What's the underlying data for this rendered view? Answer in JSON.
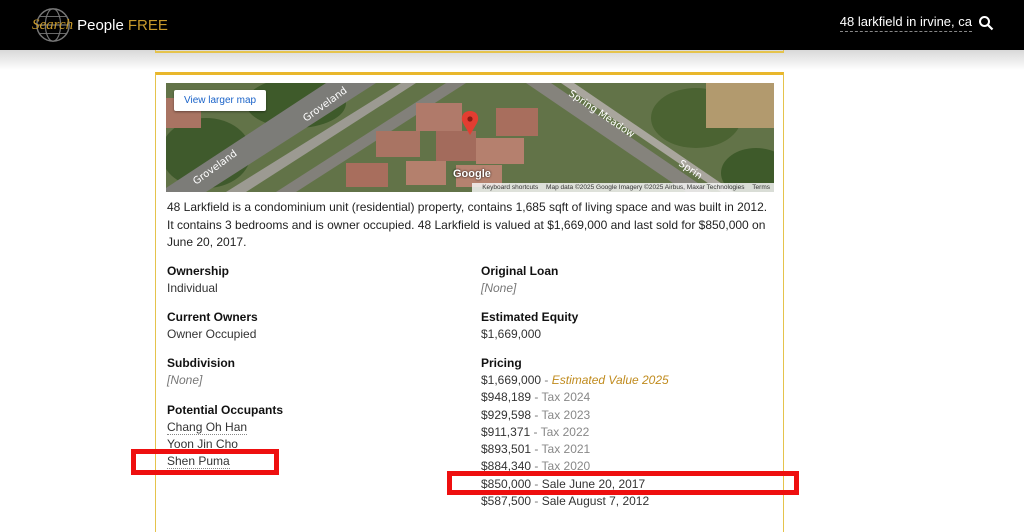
{
  "header": {
    "logo_search": "Search",
    "logo_people": "People",
    "logo_free": "FREE",
    "search_query": "48 larkfield in irvine, ca"
  },
  "map": {
    "view_larger_label": "View larger map",
    "google_mark": "Google",
    "keyboard": "Keyboard shortcuts",
    "attribution": "Map data ©2025 Google Imagery ©2025 Airbus, Maxar Technologies",
    "terms": "Terms",
    "street_1": "Groveland",
    "street_2": "Groveland",
    "street_3": "Spring Meadow",
    "street_4": "Sprin"
  },
  "description": "48 Larkfield is a condominium unit (residential) property, contains 1,685 sqft of living space and was built in 2012. It contains 3 bedrooms and is owner occupied. 48 Larkfield is valued at $1,669,000 and last sold for $850,000 on June 20, 2017.",
  "left": {
    "ownership_label": "Ownership",
    "ownership_value": "Individual",
    "owners_label": "Current Owners",
    "owners_value": "Owner Occupied",
    "subdivision_label": "Subdivision",
    "subdivision_value": "[None]",
    "occupants_label": "Potential Occupants",
    "occupants": [
      "Chang Oh Han",
      "Yoon Jin Cho",
      "Shen Puma"
    ]
  },
  "right": {
    "loan_label": "Original Loan",
    "loan_value": "[None]",
    "equity_label": "Estimated Equity",
    "equity_value": "$1,669,000",
    "pricing_label": "Pricing",
    "pricing": [
      {
        "amount": "$1,669,000",
        "sep": " - ",
        "tag": "Estimated Value 2025"
      },
      {
        "amount": "$948,189",
        "sep": " - ",
        "tag": "Tax 2024"
      },
      {
        "amount": "$929,598",
        "sep": " - ",
        "tag": "Tax 2023"
      },
      {
        "amount": "$911,371",
        "sep": " - ",
        "tag": "Tax 2022"
      },
      {
        "amount": "$893,501",
        "sep": " - ",
        "tag": "Tax 2021"
      },
      {
        "amount": "$884,340",
        "sep": " - ",
        "tag": "Tax 2020"
      },
      {
        "amount": "$850,000",
        "sep": " - ",
        "tag": "Sale June 20, 2017"
      },
      {
        "amount": "$587,500",
        "sep": " - ",
        "tag": "Sale August 7, 2012"
      }
    ]
  },
  "colors": {
    "accent_gold": "#c89a2c",
    "highlight_red": "#ee0f0f"
  }
}
